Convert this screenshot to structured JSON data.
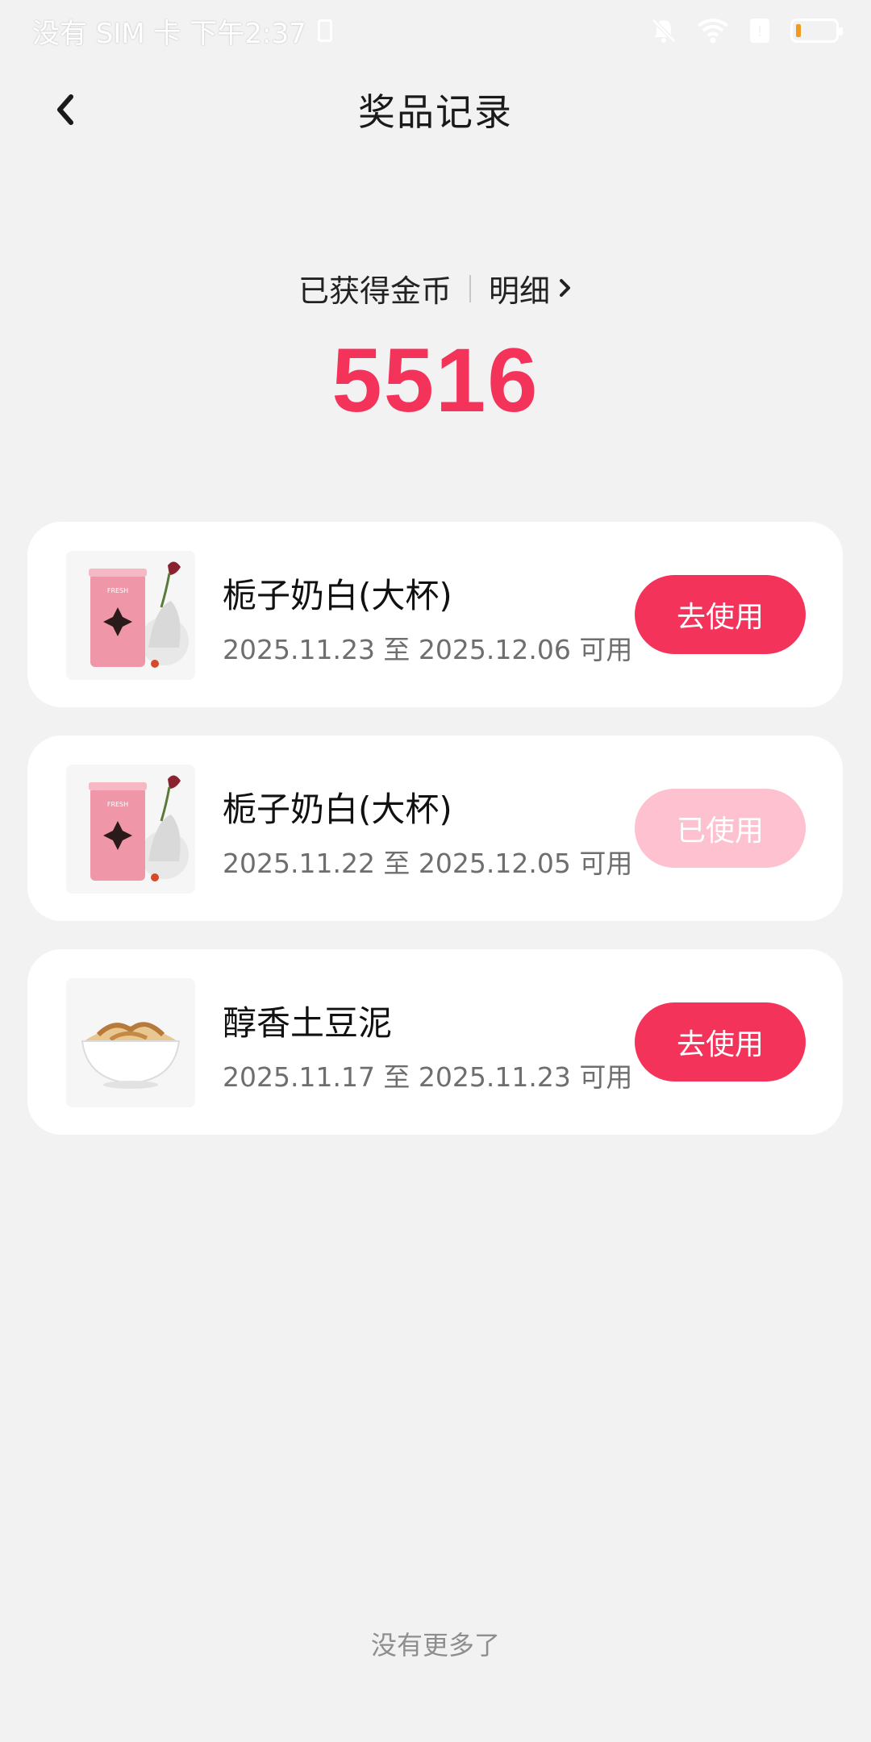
{
  "status_bar": {
    "left_text": "没有 SIM 卡 下午2:37",
    "icons": [
      "sim-icon",
      "mute-bell-icon",
      "wifi-icon",
      "sim-chip-icon",
      "battery-icon"
    ],
    "battery_level": 0.12,
    "battery_color": "#f39a1e"
  },
  "header": {
    "title": "奖品记录",
    "back_icon": "chevron-left-icon"
  },
  "coins": {
    "label": "已获得金币",
    "detail_label": "明细",
    "value": "5516",
    "accent": "#f4335b"
  },
  "items": [
    {
      "name": "栀子奶白(大杯)",
      "date": "2025.11.23 至 2025.12.06 可用",
      "button": "去使用",
      "used": false,
      "thumb": "milk-tea-cup-image"
    },
    {
      "name": "栀子奶白(大杯)",
      "date": "2025.11.22 至 2025.12.05 可用",
      "button": "已使用",
      "used": true,
      "thumb": "milk-tea-cup-image"
    },
    {
      "name": "醇香土豆泥",
      "date": "2025.11.17 至 2025.11.23 可用",
      "button": "去使用",
      "used": false,
      "thumb": "mashed-potato-bowl-image"
    }
  ],
  "footer": {
    "text": "没有更多了"
  },
  "colors": {
    "primary_button": "#f4335b",
    "disabled_button": "#fdc1cf",
    "background": "#f2f2f3"
  }
}
